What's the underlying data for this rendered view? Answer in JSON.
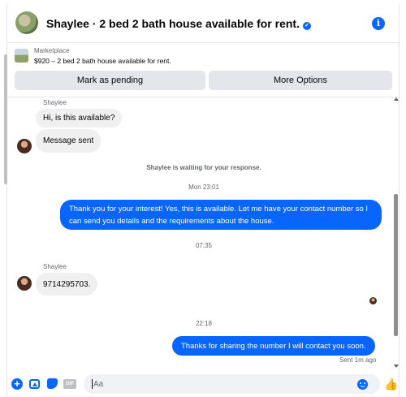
{
  "header": {
    "title": "Shaylee · 2 bed 2 bath house available for rent.",
    "verified_icon": "check-badge-icon",
    "info_icon": "info-icon"
  },
  "marketplace": {
    "label": "Marketplace",
    "listing": "$920 – 2 bed 2 bath house available for rent.",
    "mark_pending_label": "Mark as pending",
    "more_options_label": "More Options"
  },
  "messages": {
    "sender_1": "Shaylee",
    "incoming_1": "Hi, is this available?",
    "incoming_2": "Message sent",
    "waiting_note": "Shaylee is waiting for your response.",
    "timestamp_1": "Mon 23:01",
    "outgoing_1": "Thank you for your interest! Yes, this is available. Let me have your contact number so I can send you details and the requirements about the house.",
    "timestamp_2": "07:35",
    "sender_2": "Shaylee",
    "incoming_3": "9714295703.",
    "timestamp_3": "22:18",
    "outgoing_2": "Thanks for sharing the number I will contact you soon.",
    "sent_status": "Sent 1m ago"
  },
  "composer": {
    "placeholder": "Aa",
    "gif_label": "GIF"
  },
  "colors": {
    "accent": "#0866ff",
    "incoming_bubble": "#f0f0f0",
    "button_bg": "#e4e6eb"
  }
}
